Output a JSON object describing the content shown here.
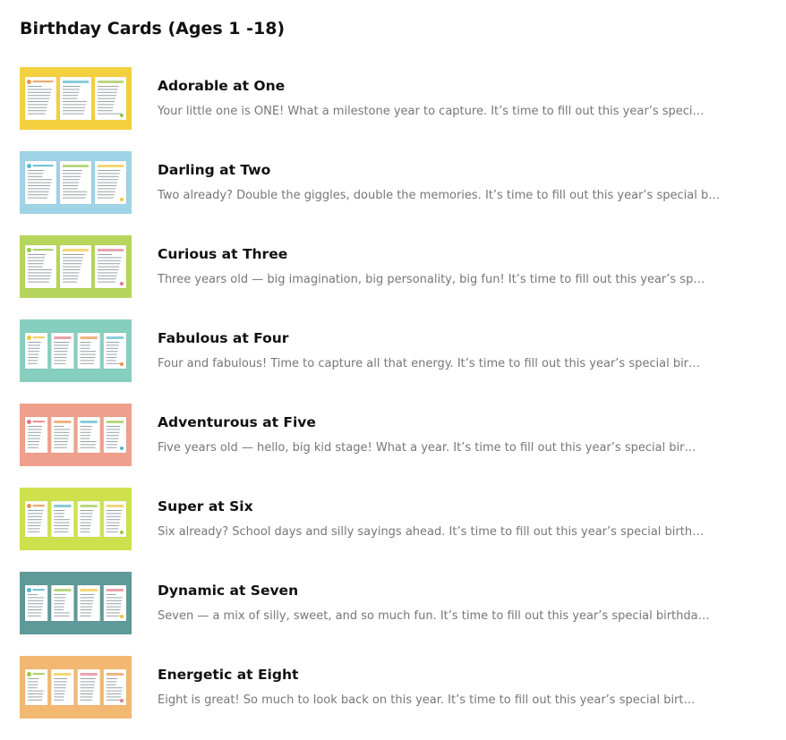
{
  "page": {
    "title": "Birthday Cards (Ages 1 -18)"
  },
  "cards": [
    {
      "title": "Adorable at One",
      "description": "Your little one is ONE! What a milestone year to capture. It’s time to fill out this year’s speci…",
      "thumb_color": "#f4d03f",
      "panels": 3
    },
    {
      "title": "Darling at Two",
      "description": "Two already? Double the giggles, double the memories. It’s time to fill out this year’s special b…",
      "thumb_color": "#9fd3e6",
      "panels": 3
    },
    {
      "title": "Curious at Three",
      "description": "Three years old — big imagination, big personality, big fun! It’s time to fill out this year’s sp…",
      "thumb_color": "#b6d55c",
      "panels": 3
    },
    {
      "title": "Fabulous at Four",
      "description": "Four and fabulous! Time to capture all that energy. It’s time to fill out this year’s special bir…",
      "thumb_color": "#86cfbf",
      "panels": 4
    },
    {
      "title": "Adventurous at Five",
      "description": "Five years old — hello, big kid stage! What a year. It’s time to fill out this year’s special bir…",
      "thumb_color": "#eea08c",
      "panels": 4
    },
    {
      "title": "Super at Six",
      "description": "Six already? School days and silly sayings ahead. It’s time to fill out this year’s special birth…",
      "thumb_color": "#cfe04f",
      "panels": 4
    },
    {
      "title": "Dynamic at Seven",
      "description": "Seven — a mix of silly, sweet, and so much fun. It’s time to fill out this year’s special birthda…",
      "thumb_color": "#5e9a98",
      "panels": 4
    },
    {
      "title": "Energetic at Eight",
      "description": "Eight is great! So much to look back on this year. It’s time to fill out this year’s special birt…",
      "thumb_color": "#f2b872",
      "panels": 4
    }
  ]
}
